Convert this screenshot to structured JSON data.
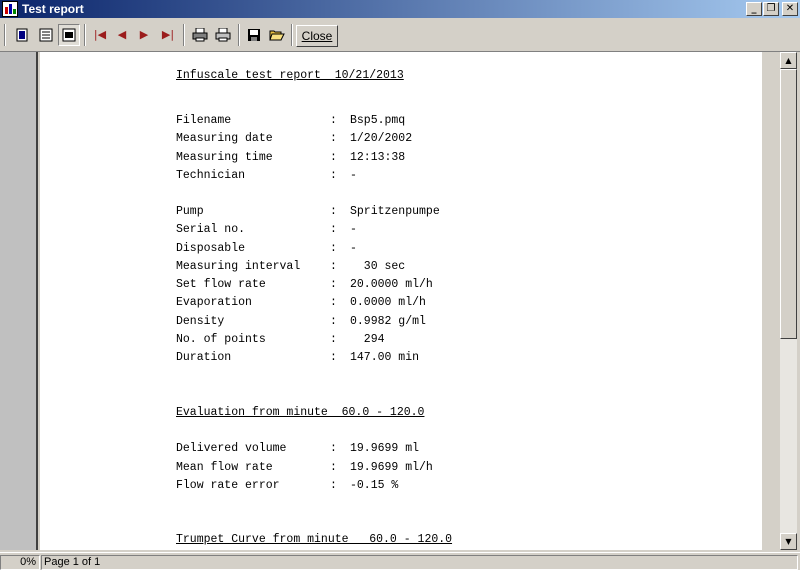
{
  "window": {
    "title": "Test report"
  },
  "toolbar": {
    "close_label": "Close"
  },
  "report": {
    "title": "Infuscale test report  10/21/2013",
    "group1": [
      {
        "label": "Filename",
        "value": "Bsp5.pmq"
      },
      {
        "label": "Measuring date",
        "value": "1/20/2002"
      },
      {
        "label": "Measuring time",
        "value": "12:13:38"
      },
      {
        "label": "Technician",
        "value": "-"
      }
    ],
    "group2": [
      {
        "label": "Pump",
        "value": "Spritzenpumpe"
      },
      {
        "label": "Serial no.",
        "value": "-"
      },
      {
        "label": "Disposable",
        "value": "-"
      },
      {
        "label": "Measuring interval",
        "value": "  30 sec"
      },
      {
        "label": "Set flow rate",
        "value": "20.0000 ml/h"
      },
      {
        "label": "Evaporation",
        "value": "0.0000 ml/h"
      },
      {
        "label": "Density",
        "value": "0.9982 g/ml"
      },
      {
        "label": "No. of points",
        "value": "  294"
      },
      {
        "label": "Duration",
        "value": "147.00 min"
      }
    ],
    "evaluation_heading": "Evaluation from minute  60.0 - 120.0",
    "group3": [
      {
        "label": "Delivered volume",
        "value": "19.9699 ml"
      },
      {
        "label": "Mean flow rate",
        "value": "19.9699 ml/h"
      },
      {
        "label": "Flow rate error",
        "value": "-0.15 %"
      }
    ],
    "trumpet_heading": "Trumpet Curve from minute   60.0 - 120.0",
    "separator": ":"
  },
  "status": {
    "zoom": "0%",
    "page": "Page 1 of 1"
  },
  "icons": [
    "app-icon",
    "one-page-icon",
    "multi-page-icon",
    "page-width-icon",
    "first-page-icon",
    "prev-page-icon",
    "next-page-icon",
    "last-page-icon",
    "printer-setup-icon",
    "print-icon",
    "save-icon",
    "open-folder-icon",
    "minimize-icon",
    "restore-icon",
    "close-icon",
    "scroll-up-icon",
    "scroll-down-icon"
  ]
}
